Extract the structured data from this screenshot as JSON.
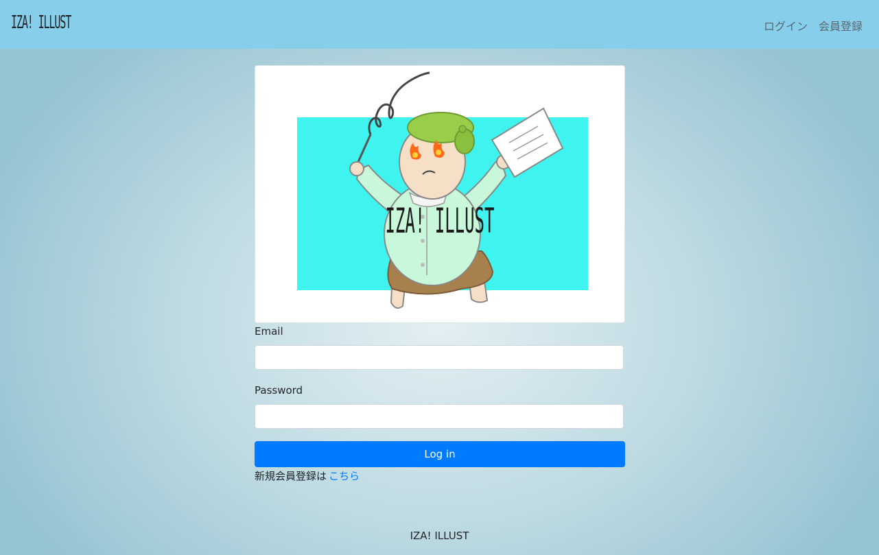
{
  "navbar": {
    "brand": "IZA! ILLUST",
    "links": [
      {
        "label": "ログイン"
      },
      {
        "label": "会員登録"
      }
    ]
  },
  "hero": {
    "logo_text": "IZA! ILLUST",
    "background_color": "#3ff4ef"
  },
  "form": {
    "email_label": "Email",
    "email_value": "",
    "password_label": "Password",
    "password_value": "",
    "submit_label": "Log in",
    "signup_prompt": "新規会員登録は",
    "signup_link": "こちら"
  },
  "footer": {
    "text": "IZA! ILLUST"
  },
  "colors": {
    "navbar": "#87ceeb",
    "primary": "#007bff"
  }
}
